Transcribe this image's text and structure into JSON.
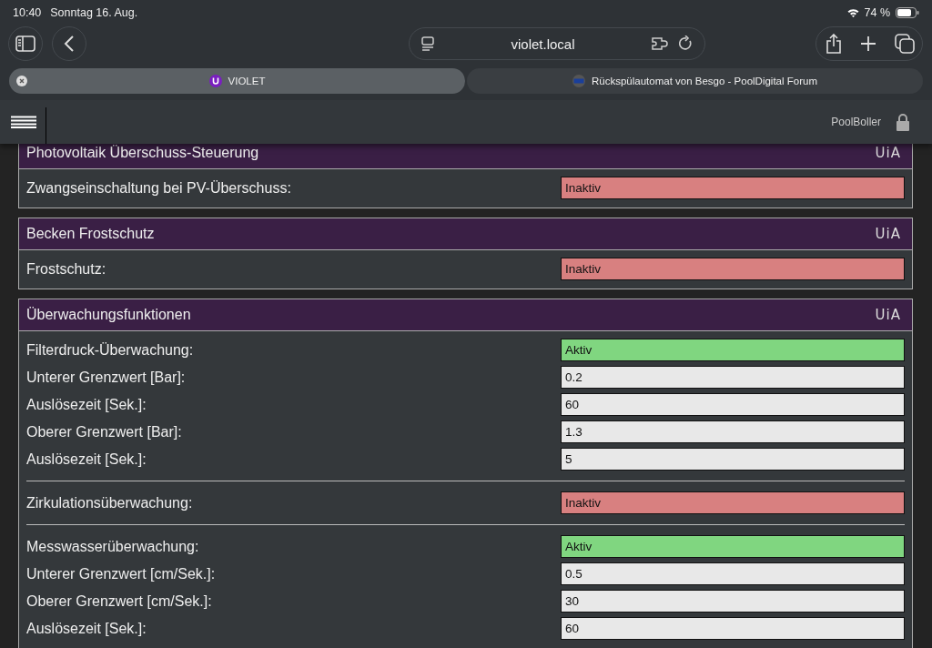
{
  "status_bar": {
    "time": "10:40",
    "date": "Sonntag 16. Aug.",
    "battery": "74 %"
  },
  "browser": {
    "address": "violet.local",
    "tabs": [
      {
        "title": "VIOLET",
        "selected": true
      },
      {
        "title": "Rückspülautomat von Besgo - PoolDigital Forum",
        "selected": false
      }
    ]
  },
  "app_header": {
    "user": "PoolBoller"
  },
  "panels": [
    {
      "title": "Photovoltaik Überschuss-Steuerung",
      "logo": "UiA",
      "groups": [
        {
          "rows": [
            {
              "label": "Zwangseinschaltung bei PV-Überschuss:",
              "value": "Inaktiv",
              "kind": "status",
              "on": false
            }
          ]
        }
      ]
    },
    {
      "title": "Becken Frostschutz",
      "logo": "UiA",
      "groups": [
        {
          "rows": [
            {
              "label": "Frostschutz:",
              "value": "Inaktiv",
              "kind": "status",
              "on": false
            }
          ]
        }
      ]
    },
    {
      "title": "Überwachungsfunktionen",
      "logo": "UiA",
      "groups": [
        {
          "rows": [
            {
              "label": "Filterdruck-Überwachung:",
              "value": "Aktiv",
              "kind": "status",
              "on": true
            },
            {
              "label": "Unterer Grenzwert [Bar]:",
              "value": "0.2",
              "kind": "number"
            },
            {
              "label": "Auslösezeit [Sek.]:",
              "value": "60",
              "kind": "number"
            },
            {
              "label": "Oberer Grenzwert [Bar]:",
              "value": "1.3",
              "kind": "number"
            },
            {
              "label": "Auslösezeit [Sek.]:",
              "value": "5",
              "kind": "number"
            }
          ]
        },
        {
          "rows": [
            {
              "label": "Zirkulationsüberwachung:",
              "value": "Inaktiv",
              "kind": "status",
              "on": false
            }
          ]
        },
        {
          "rows": [
            {
              "label": "Messwasserüberwachung:",
              "value": "Aktiv",
              "kind": "status",
              "on": true
            },
            {
              "label": "Unterer Grenzwert [cm/Sek.]:",
              "value": "0.5",
              "kind": "number"
            },
            {
              "label": "Oberer Grenzwert [cm/Sek.]:",
              "value": "30",
              "kind": "number"
            },
            {
              "label": "Auslösezeit [Sek.]:",
              "value": "60",
              "kind": "number"
            }
          ]
        }
      ]
    }
  ]
}
